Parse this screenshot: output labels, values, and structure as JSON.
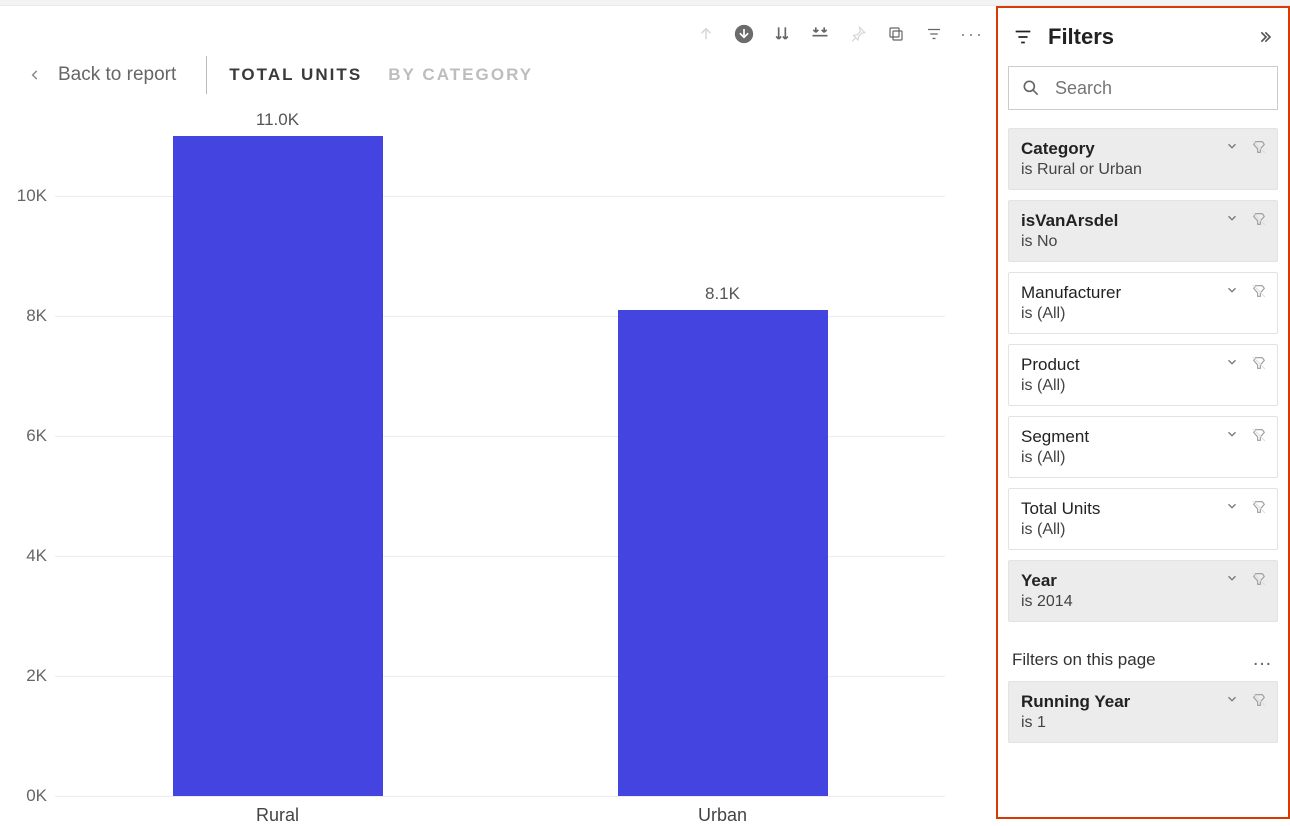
{
  "nav": {
    "back_label": "Back to report",
    "tabs": [
      {
        "label": "TOTAL UNITS",
        "active": true
      },
      {
        "label": "BY CATEGORY",
        "active": false
      }
    ]
  },
  "chart_data": {
    "type": "bar",
    "categories": [
      "Rural",
      "Urban"
    ],
    "values": [
      11000,
      8100
    ],
    "value_labels": [
      "11.0K",
      "8.1K"
    ],
    "y_ticks": [
      0,
      2000,
      4000,
      6000,
      8000,
      10000
    ],
    "y_tick_labels": [
      "0K",
      "2K",
      "4K",
      "6K",
      "8K",
      "10K"
    ],
    "ylim": [
      0,
      11000
    ],
    "bar_color": "#4445e0",
    "title": "",
    "xlabel": "",
    "ylabel": ""
  },
  "filters": {
    "title": "Filters",
    "search_placeholder": "Search",
    "cards": [
      {
        "title": "Category",
        "subtitle": "is Rural or Urban",
        "active": true
      },
      {
        "title": "isVanArsdel",
        "subtitle": "is No",
        "active": true
      },
      {
        "title": "Manufacturer",
        "subtitle": "is (All)",
        "active": false
      },
      {
        "title": "Product",
        "subtitle": "is (All)",
        "active": false
      },
      {
        "title": "Segment",
        "subtitle": "is (All)",
        "active": false
      },
      {
        "title": "Total Units",
        "subtitle": "is (All)",
        "active": false
      },
      {
        "title": "Year",
        "subtitle": "is 2014",
        "active": true
      }
    ],
    "page_section_label": "Filters on this page",
    "page_cards": [
      {
        "title": "Running Year",
        "subtitle": "is 1",
        "active": true
      }
    ]
  }
}
